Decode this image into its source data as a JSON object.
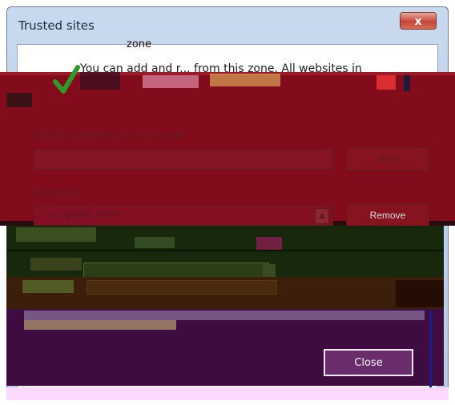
{
  "dialog": {
    "title": "Trusted sites",
    "close_glyph": "x",
    "info_text": "You can add and r... from this zone. All websites in",
    "info_text_line2": "zone",
    "add_label": "Add this website to the zone:",
    "add_input_value": "",
    "add_button_label": "Add",
    "websites_label": "Websites:",
    "websites": [
      "*.sciquest.com"
    ],
    "remove_button_label": "Remove",
    "close_button_label": "Close"
  },
  "colors": {
    "close_red": "#c7443a",
    "maroon_overlay": "#820c1c",
    "green_band": "#17280d",
    "purple_band": "#3e0c40"
  }
}
